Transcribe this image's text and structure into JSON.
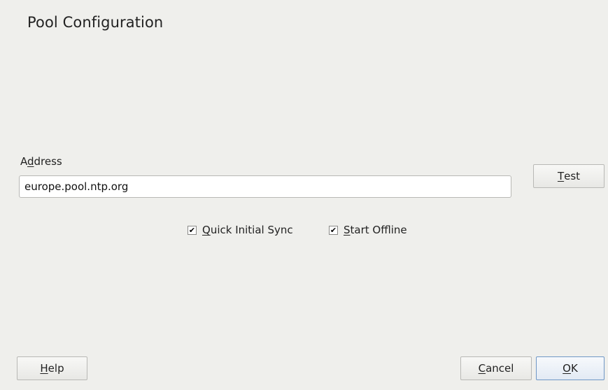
{
  "dialog": {
    "title": "Pool Configuration"
  },
  "address": {
    "label_prefix": "A",
    "label_underlined": "d",
    "label_suffix": "dress",
    "value": "europe.pool.ntp.org"
  },
  "buttons": {
    "test_prefix": "",
    "test_underlined": "T",
    "test_suffix": "est",
    "help_prefix": "",
    "help_underlined": "H",
    "help_suffix": "elp",
    "cancel_prefix": "",
    "cancel_underlined": "C",
    "cancel_suffix": "ancel",
    "ok_prefix": "",
    "ok_underlined": "O",
    "ok_suffix": "K"
  },
  "options": {
    "quick_sync": {
      "checked": true,
      "mark": "✔",
      "label_prefix": "",
      "label_underlined": "Q",
      "label_suffix": "uick Initial Sync"
    },
    "start_offline": {
      "checked": true,
      "mark": "✔",
      "label_prefix": "",
      "label_underlined": "S",
      "label_suffix": "tart Offline"
    }
  },
  "colors": {
    "background": "#efefec",
    "input_border": "#b8b8b5",
    "ok_border": "#6f97c6"
  }
}
